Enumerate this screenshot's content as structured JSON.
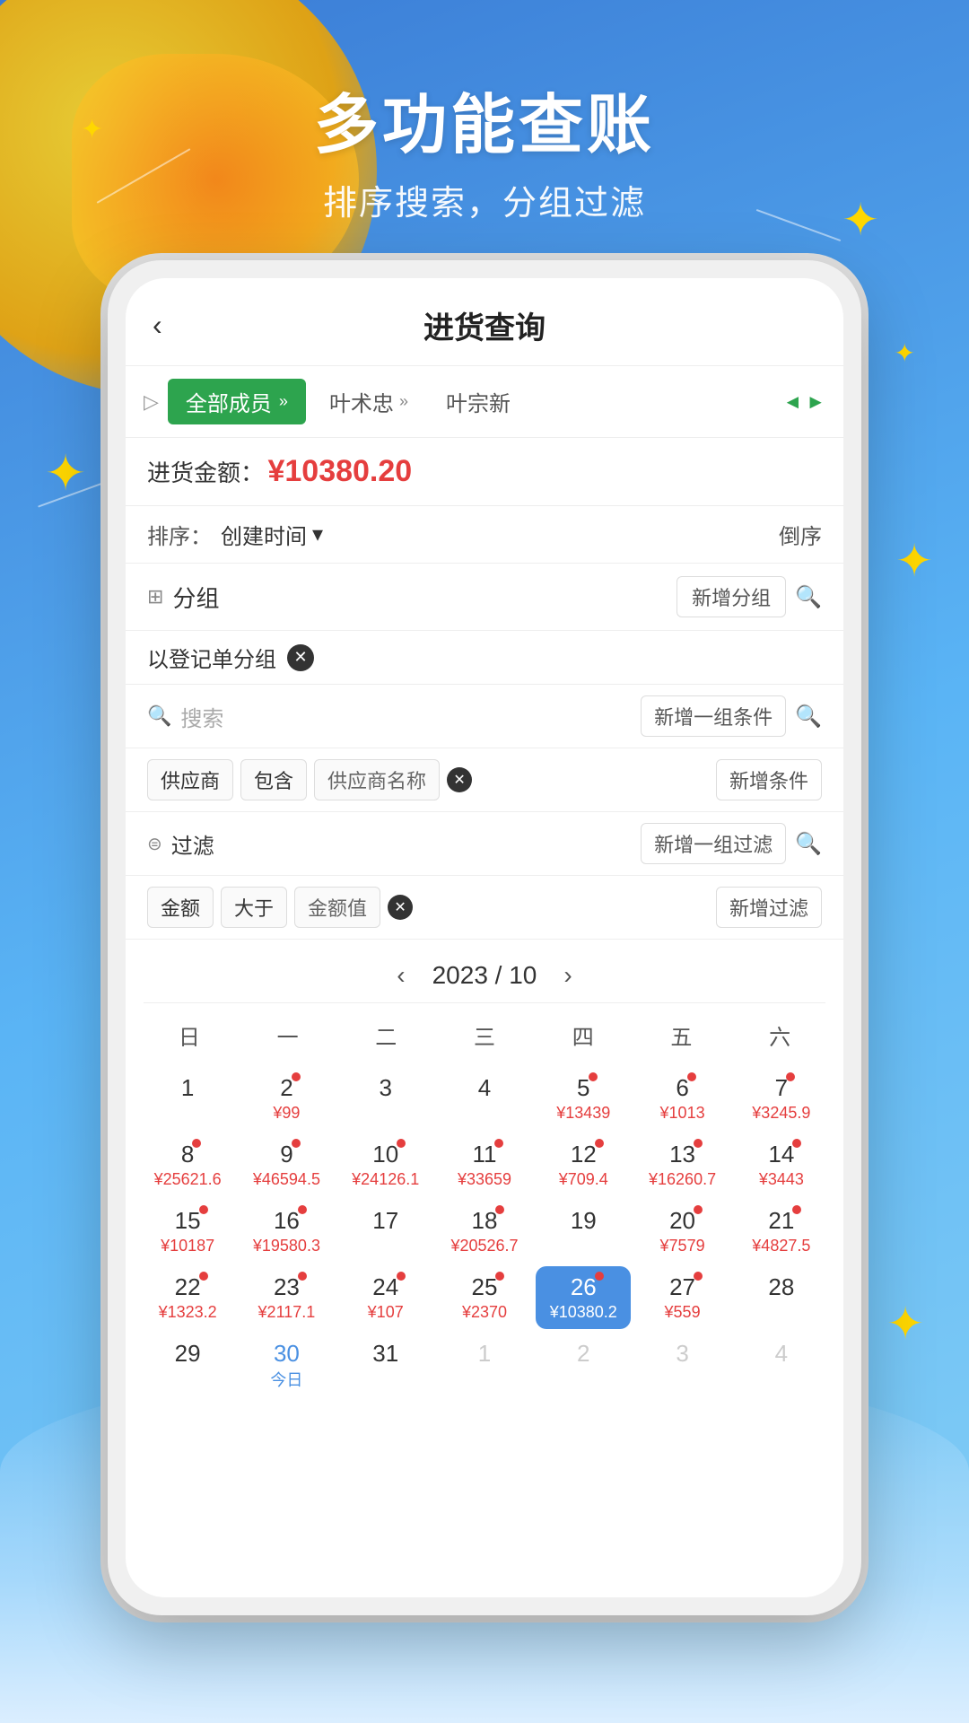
{
  "background": {
    "gradient_start": "#3a7bd5",
    "gradient_end": "#87d0f5"
  },
  "header": {
    "main_title": "多功能查账",
    "sub_title": "排序搜索，分组过滤"
  },
  "app": {
    "title": "进货查询",
    "back_label": "‹",
    "members": [
      {
        "label": "全部成员",
        "active": true
      },
      {
        "label": "叶术忠",
        "active": false
      },
      {
        "label": "叶宗新",
        "active": false
      }
    ],
    "amount_label": "进货金额：",
    "amount_value": "¥10380.20",
    "sort_label": "排序：",
    "sort_value": "创建时间",
    "sort_direction": "倒序",
    "group_label": "分组",
    "group_new_btn": "新增分组",
    "group_tag": "以登记单分组",
    "search_placeholder": "搜索",
    "search_new_btn": "新增一组条件",
    "cond_supplier": "供应商",
    "cond_include": "包含",
    "cond_value": "供应商名称",
    "cond_add": "新增条件",
    "filter_label": "过滤",
    "filter_new_group_btn": "新增一组过滤",
    "filter_amount": "金额",
    "filter_greater": "大于",
    "filter_amount_value": "金额值",
    "filter_add": "新增过滤",
    "calendar": {
      "year_month": "2023 / 10",
      "weekdays": [
        "日",
        "一",
        "二",
        "三",
        "四",
        "五",
        "六"
      ],
      "weeks": [
        [
          {
            "num": "1",
            "dot": false,
            "amount": "",
            "type": "normal"
          },
          {
            "num": "2",
            "dot": true,
            "amount": "¥99",
            "type": "normal"
          },
          {
            "num": "3",
            "dot": false,
            "amount": "",
            "type": "normal"
          },
          {
            "num": "4",
            "dot": false,
            "amount": "",
            "type": "normal"
          },
          {
            "num": "5",
            "dot": true,
            "amount": "¥13439",
            "type": "normal"
          },
          {
            "num": "6",
            "dot": true,
            "amount": "¥1013",
            "type": "normal"
          },
          {
            "num": "7",
            "dot": true,
            "amount": "¥3245.9",
            "type": "normal"
          }
        ],
        [
          {
            "num": "8",
            "dot": true,
            "amount": "¥25621.6",
            "type": "normal"
          },
          {
            "num": "9",
            "dot": true,
            "amount": "¥46594.5",
            "type": "normal"
          },
          {
            "num": "10",
            "dot": true,
            "amount": "¥24126.1",
            "type": "normal"
          },
          {
            "num": "11",
            "dot": true,
            "amount": "¥33659",
            "type": "normal"
          },
          {
            "num": "12",
            "dot": true,
            "amount": "¥709.4",
            "type": "normal"
          },
          {
            "num": "13",
            "dot": true,
            "amount": "¥16260.7",
            "type": "normal"
          },
          {
            "num": "14",
            "dot": true,
            "amount": "¥3443",
            "type": "normal"
          }
        ],
        [
          {
            "num": "15",
            "dot": true,
            "amount": "¥10187",
            "type": "normal"
          },
          {
            "num": "16",
            "dot": true,
            "amount": "¥19580.3",
            "type": "normal"
          },
          {
            "num": "17",
            "dot": false,
            "amount": "",
            "type": "normal"
          },
          {
            "num": "18",
            "dot": true,
            "amount": "¥20526.7",
            "type": "normal"
          },
          {
            "num": "19",
            "dot": false,
            "amount": "",
            "type": "normal"
          },
          {
            "num": "20",
            "dot": true,
            "amount": "¥7579",
            "type": "normal"
          },
          {
            "num": "21",
            "dot": true,
            "amount": "¥4827.5",
            "type": "normal"
          }
        ],
        [
          {
            "num": "22",
            "dot": true,
            "amount": "¥1323.2",
            "type": "normal"
          },
          {
            "num": "23",
            "dot": true,
            "amount": "¥2117.1",
            "type": "normal"
          },
          {
            "num": "24",
            "dot": true,
            "amount": "¥107",
            "type": "normal"
          },
          {
            "num": "25",
            "dot": true,
            "amount": "¥2370",
            "type": "normal"
          },
          {
            "num": "26",
            "dot": true,
            "amount": "¥10380.2",
            "type": "selected"
          },
          {
            "num": "27",
            "dot": true,
            "amount": "¥559",
            "type": "normal"
          },
          {
            "num": "28",
            "dot": false,
            "amount": "",
            "type": "normal"
          }
        ],
        [
          {
            "num": "29",
            "dot": false,
            "amount": "",
            "type": "normal"
          },
          {
            "num": "30",
            "dot": false,
            "amount": "今日",
            "type": "today"
          },
          {
            "num": "31",
            "dot": false,
            "amount": "",
            "type": "normal"
          },
          {
            "num": "1",
            "dot": false,
            "amount": "",
            "type": "gray"
          },
          {
            "num": "2",
            "dot": false,
            "amount": "",
            "type": "gray"
          },
          {
            "num": "3",
            "dot": false,
            "amount": "",
            "type": "gray"
          },
          {
            "num": "4",
            "dot": false,
            "amount": "",
            "type": "gray"
          }
        ]
      ]
    }
  }
}
